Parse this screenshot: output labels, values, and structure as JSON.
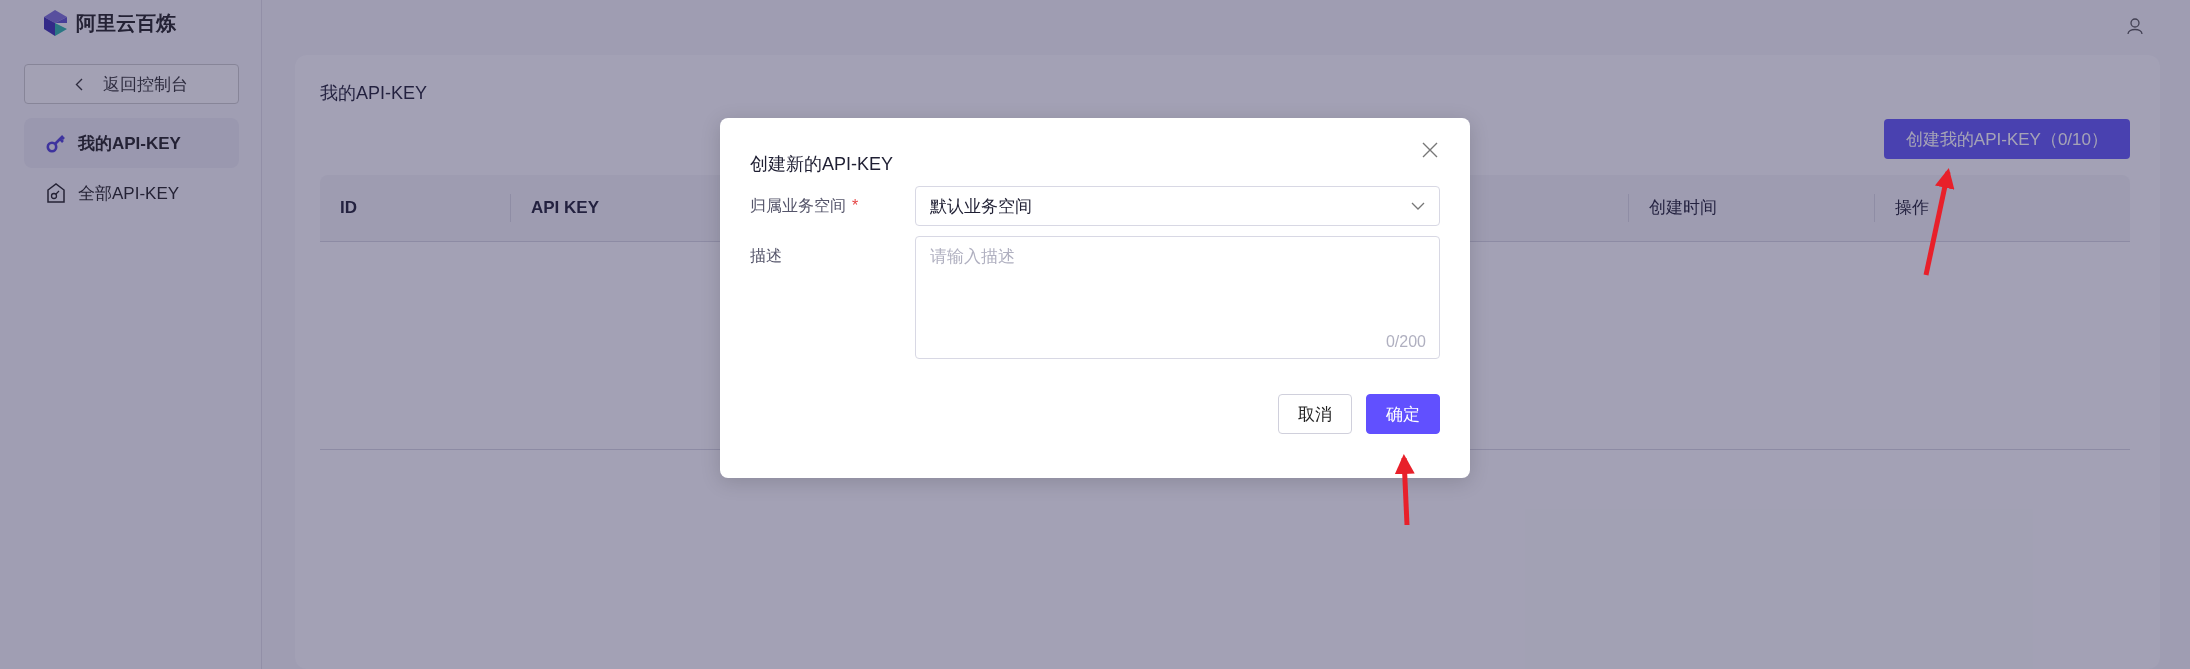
{
  "brand": {
    "name": "阿里云百炼"
  },
  "sidebar": {
    "back_button": "返回控制台",
    "items": [
      {
        "label": "我的API-KEY",
        "selected": true,
        "kind": "key"
      },
      {
        "label": "全部API-KEY",
        "selected": false,
        "kind": "house"
      }
    ]
  },
  "page": {
    "title": "我的API-KEY",
    "create_button": "创建我的API-KEY（0/10）",
    "table": {
      "columns": [
        "ID",
        "API KEY",
        "创建时间",
        "操作"
      ]
    }
  },
  "dialog": {
    "title": "创建新的API-KEY",
    "fields": [
      {
        "kind": "select",
        "label": "归属业务空间",
        "required_mark": "*",
        "value": "默认业务空间"
      },
      {
        "kind": "textarea",
        "label": "描述",
        "placeholder": "请输入描述",
        "counter": "0/200"
      }
    ],
    "buttons": [
      {
        "label": "取消",
        "primary": false
      },
      {
        "label": "确定",
        "primary": true
      }
    ]
  }
}
